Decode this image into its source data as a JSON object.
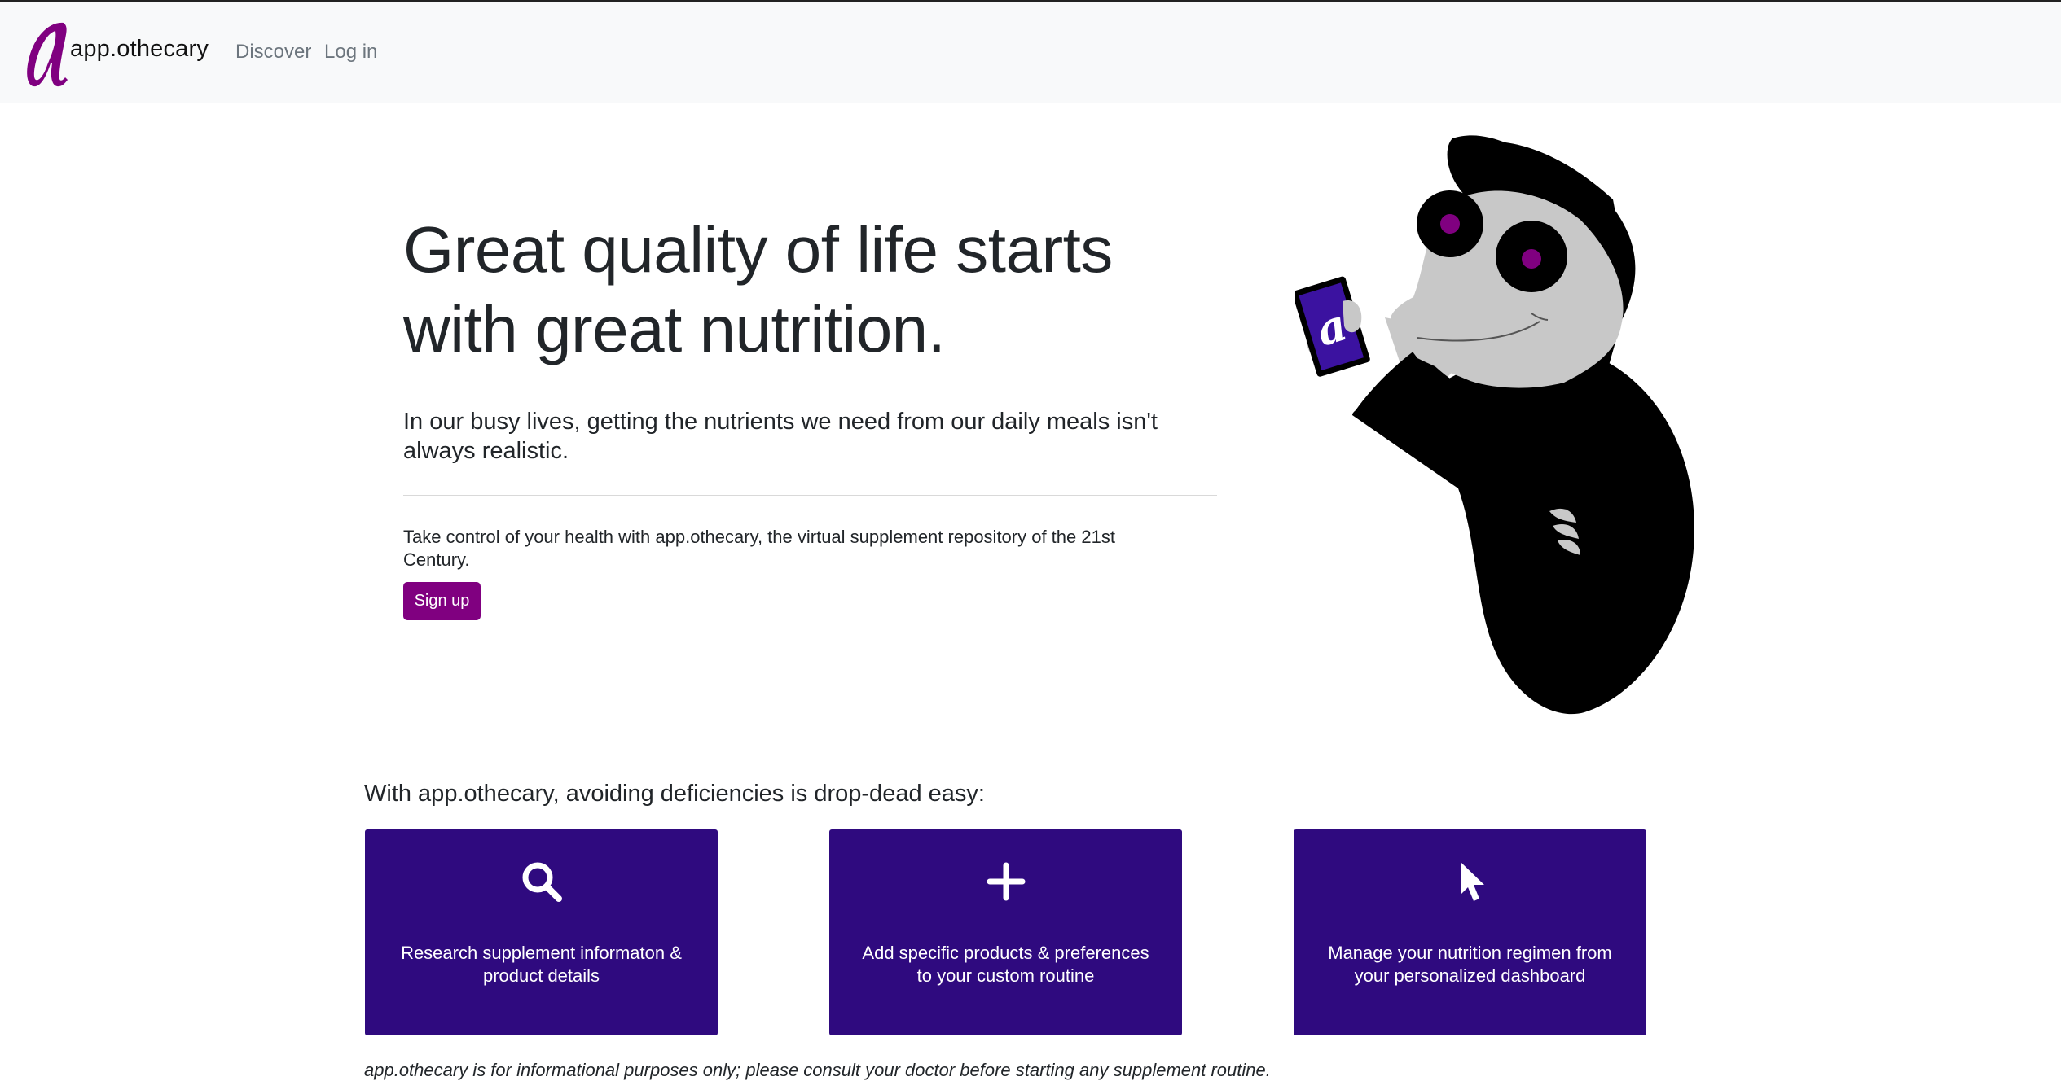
{
  "navbar": {
    "logo_letter": "a",
    "brand": "app.othecary",
    "links": [
      {
        "label": "Discover"
      },
      {
        "label": "Log in"
      }
    ]
  },
  "hero": {
    "title_line1": "Great quality of life starts",
    "title_line2": "with great nutrition.",
    "lead": "In our busy lives, getting the nutrients we need from our daily meals isn't always realistic.",
    "text": "Take control of your health with app.othecary, the virtual supplement repository of the 21st Century.",
    "signup_label": "Sign up",
    "mascot_card_letter": "a"
  },
  "steps": {
    "intro": "With app.othecary, avoiding deficiencies is drop-dead easy:",
    "cards": [
      {
        "icon": "search-icon",
        "text": "Research supplement informaton & product details"
      },
      {
        "icon": "plus-icon",
        "text": "Add specific products & preferences to your custom routine"
      },
      {
        "icon": "cursor-icon",
        "text": "Manage your nutrition regimen from your personalized dashboard"
      }
    ]
  },
  "disclaimer": "app.othecary is for informational purposes only; please consult your doctor before starting any supplement routine.",
  "colors": {
    "brand_purple": "#800080",
    "card_indigo": "#2f0a7f",
    "navbar_bg": "#f8f9fa",
    "mascot_black": "#000000",
    "mascot_grey": "#c8c8c8"
  }
}
